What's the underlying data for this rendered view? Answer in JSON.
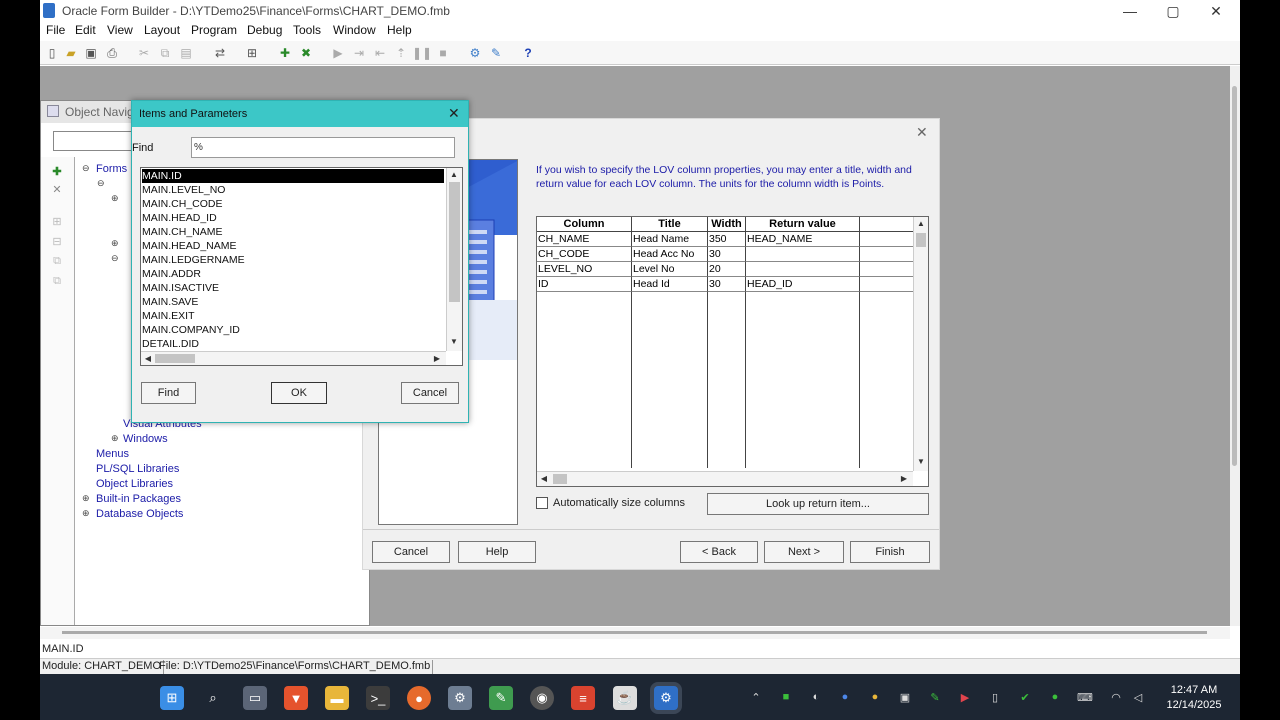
{
  "window": {
    "title": "Oracle Form Builder - D:\\YTDemo25\\Finance\\Forms\\CHART_DEMO.fmb",
    "controls": {
      "minimize": "—",
      "maximize": "▢",
      "close": "✕"
    }
  },
  "menu": [
    "File",
    "Edit",
    "View",
    "Layout",
    "Program",
    "Debug",
    "Tools",
    "Window",
    "Help"
  ],
  "object_navigator": {
    "title": "Object Navig",
    "tree": {
      "forms": "Forms",
      "windows": "Windows",
      "visual_attributes": "Visual Attributes",
      "menus": "Menus",
      "plsql_libraries": "PL/SQL Libraries",
      "object_libraries": "Object Libraries",
      "builtin_packages": "Built-in Packages",
      "database_objects": "Database Objects"
    }
  },
  "lov_wizard": {
    "instruction": "If you wish to specify the LOV column properties, you may enter a title, width and return value for each LOV column. The units for the column width is Points.",
    "columns": [
      "Column",
      "Title",
      "Width",
      "Return value"
    ],
    "rows": [
      {
        "column": "CH_NAME",
        "title": "Head Name",
        "width": "350",
        "return_value": "HEAD_NAME"
      },
      {
        "column": "CH_CODE",
        "title": "Head Acc No",
        "width": "30",
        "return_value": ""
      },
      {
        "column": "LEVEL_NO",
        "title": "Level No",
        "width": "20",
        "return_value": ""
      },
      {
        "column": "ID",
        "title": "Head Id",
        "width": "30",
        "return_value": "HEAD_ID"
      }
    ],
    "auto_size_label": "Automatically size columns",
    "auto_size_checked": false,
    "lookup_button": "Look up return item...",
    "buttons": {
      "cancel": "Cancel",
      "help": "Help",
      "back": "< Back",
      "next": "Next >",
      "finish": "Finish"
    }
  },
  "items_dialog": {
    "title": "Items and Parameters",
    "find_label": "Find",
    "find_value": "%",
    "items": [
      "MAIN.ID",
      "MAIN.LEVEL_NO",
      "MAIN.CH_CODE",
      "MAIN.HEAD_ID",
      "MAIN.CH_NAME",
      "MAIN.HEAD_NAME",
      "MAIN.LEDGERNAME",
      "MAIN.ADDR",
      "MAIN.ISACTIVE",
      "MAIN.SAVE",
      "MAIN.EXIT",
      "MAIN.COMPANY_ID",
      "DETAIL.DID"
    ],
    "selected": "MAIN.ID",
    "buttons": {
      "find": "Find",
      "ok": "OK",
      "cancel": "Cancel"
    }
  },
  "status": {
    "line": "MAIN.ID",
    "module": "Module: CHART_DEMO",
    "file": "File: D:\\YTDemo25\\Finance\\Forms\\CHART_DEMO.fmb"
  },
  "taskbar": {
    "apps": [
      "start-icon",
      "search-icon",
      "task-view-icon",
      "brave-icon",
      "file-explorer-icon",
      "terminal-icon",
      "firefox-icon",
      "settings-icon",
      "notepad-icon",
      "chrome-icon",
      "todoist-icon",
      "java-icon",
      "form-builder-icon"
    ],
    "time": "12:47 AM",
    "date": "12/14/2025"
  }
}
